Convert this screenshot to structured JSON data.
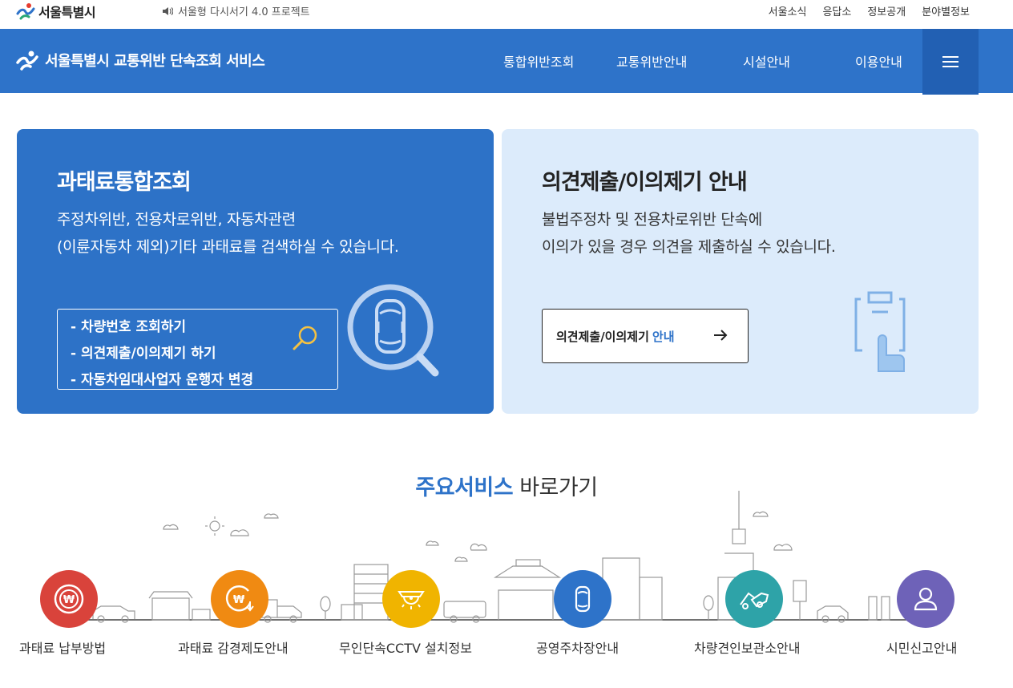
{
  "topbar": {
    "logo_text": "서울특별시",
    "slogan": "서울형 다시서기 4.0 프로젝트",
    "links": [
      "서울소식",
      "응답소",
      "정보공개",
      "분야별정보"
    ]
  },
  "header": {
    "brand": "서울특별시 교통위반 단속조회 서비스",
    "menu": [
      "통합위반조회",
      "교통위반안내",
      "시설안내",
      "이용안내"
    ]
  },
  "card_left": {
    "title": "과태료통합조회",
    "desc_line1": "주정차위반, 전용차로위반, 자동차관련",
    "desc_line2": "(이륜자동차 제외)기타 과태료를 검색하실 수 있습니다.",
    "links": [
      "- 차량번호 조회하기",
      "- 의견제출/이의제기 하기",
      "- 자동차임대사업자 운행자 변경"
    ]
  },
  "card_right": {
    "title": "의견제출/이의제기 안내",
    "desc_line1": "불법주정차 및 전용차로위반 단속에",
    "desc_line2": "이의가 있을 경우 의견을 제출하실 수 있습니다.",
    "button_main": "의견제출/이의제기",
    "button_accent": "안내"
  },
  "services": {
    "title_strong": "주요서비스",
    "title_light": "바로가기",
    "items": [
      {
        "label": "과태료 납부방법",
        "color": "#d9433b"
      },
      {
        "label": "과태료 감경제도안내",
        "color": "#f08a12"
      },
      {
        "label": "무인단속CCTV 설치정보",
        "color": "#f0b400"
      },
      {
        "label": "공영주차장안내",
        "color": "#2e73c9"
      },
      {
        "label": "차량견인보관소안내",
        "color": "#2ea3a8"
      },
      {
        "label": "시민신고안내",
        "color": "#6e62b8"
      }
    ]
  }
}
